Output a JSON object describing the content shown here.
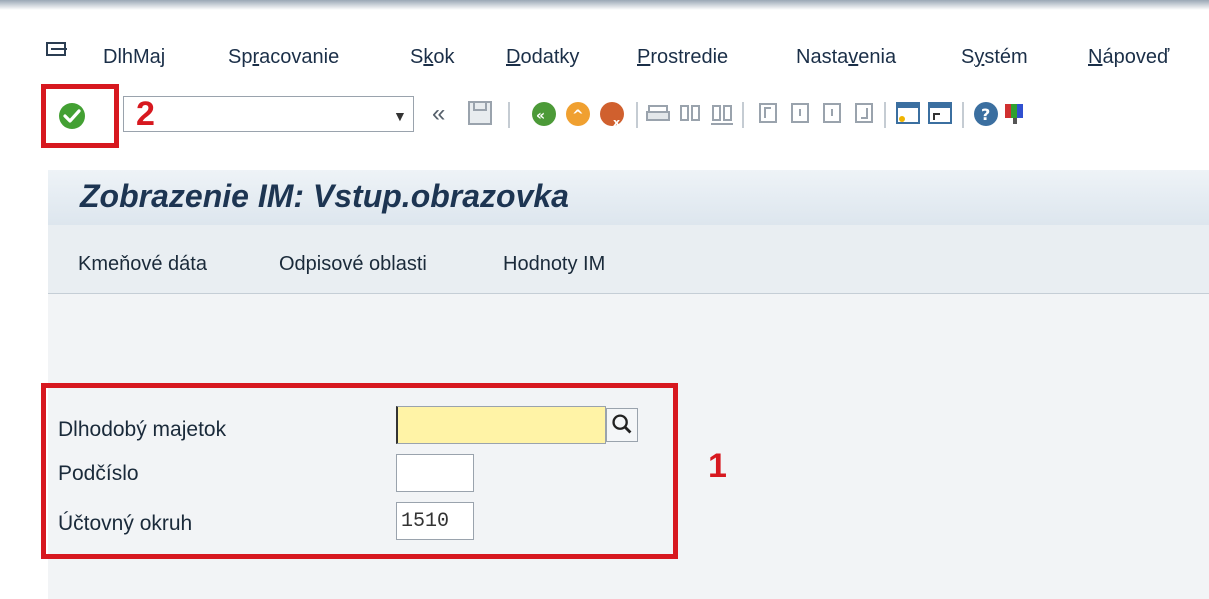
{
  "menu": {
    "items": [
      {
        "pre": "DlhMa",
        "ul": "j",
        "post": ""
      },
      {
        "pre": "Sp",
        "ul": "r",
        "post": "acovanie"
      },
      {
        "pre": "S",
        "ul": "k",
        "post": "ok"
      },
      {
        "pre": "",
        "ul": "D",
        "post": "odatky"
      },
      {
        "pre": "",
        "ul": "P",
        "post": "rostredie"
      },
      {
        "pre": "Nasta",
        "ul": "v",
        "post": "enia"
      },
      {
        "pre": "S",
        "ul": "y",
        "post": "stém"
      },
      {
        "pre": "",
        "ul": "N",
        "post": "ápoveď"
      }
    ]
  },
  "toolbar": {
    "command_value": "",
    "icons": [
      "enter-icon",
      "command-dropdown-icon",
      "back-arrows-icon",
      "save-icon",
      "back-icon",
      "exit-icon",
      "cancel-icon",
      "print-icon",
      "find-icon",
      "find-next-icon",
      "first-page-icon",
      "previous-page-icon",
      "next-page-icon",
      "last-page-icon",
      "new-session-icon",
      "shortcut-icon",
      "help-icon",
      "customize-layout-icon"
    ]
  },
  "callouts": {
    "one": "1",
    "two": "2"
  },
  "title": "Zobrazenie IM: Vstup.obrazovka",
  "app_toolbar": {
    "master_data": "Kmeňové dáta",
    "depreciation_areas": "Odpisové oblasti",
    "asset_values": "Hodnoty IM"
  },
  "form": {
    "asset_label": "Dlhodobý majetok",
    "asset_value": "",
    "subnumber_label": "Podčíslo",
    "subnumber_value": "",
    "company_code_label": "Účtovný okruh",
    "company_code_value": "1510"
  },
  "colors": {
    "highlight": "#d7181f",
    "required_field": "#fff3a6"
  }
}
